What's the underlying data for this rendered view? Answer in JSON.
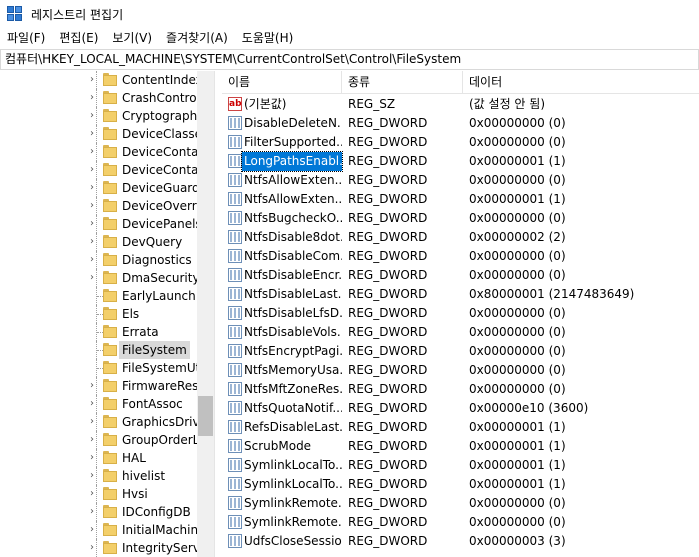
{
  "window": {
    "title": "레지스트리 편집기"
  },
  "menu": [
    {
      "label": "파일(F)"
    },
    {
      "label": "편집(E)"
    },
    {
      "label": "보기(V)"
    },
    {
      "label": "즐겨찾기(A)"
    },
    {
      "label": "도움말(H)"
    }
  ],
  "address": "컴퓨터\\HKEY_LOCAL_MACHINE\\SYSTEM\\CurrentControlSet\\Control\\FileSystem",
  "tree": {
    "selected": "FileSystem",
    "items": [
      {
        "label": "ContentIndex"
      },
      {
        "label": "CrashControl"
      },
      {
        "label": "Cryptography"
      },
      {
        "label": "DeviceClasses"
      },
      {
        "label": "DeviceContair"
      },
      {
        "label": "DeviceContair"
      },
      {
        "label": "DeviceGuard"
      },
      {
        "label": "DeviceOverrid"
      },
      {
        "label": "DevicePanels"
      },
      {
        "label": "DevQuery"
      },
      {
        "label": "Diagnostics"
      },
      {
        "label": "DmaSecurity"
      },
      {
        "label": "EarlyLaunch"
      },
      {
        "label": "Els"
      },
      {
        "label": "Errata"
      },
      {
        "label": "FileSystem"
      },
      {
        "label": "FileSystemUtil"
      },
      {
        "label": "FirmwareReso"
      },
      {
        "label": "FontAssoc"
      },
      {
        "label": "GraphicsDrive"
      },
      {
        "label": "GroupOrderLis"
      },
      {
        "label": "HAL"
      },
      {
        "label": "hivelist"
      },
      {
        "label": "Hvsi"
      },
      {
        "label": "IDConfigDB"
      },
      {
        "label": "InitialMachine"
      },
      {
        "label": "IntegrityServic"
      }
    ]
  },
  "list": {
    "columns": {
      "name": "이름",
      "type": "종류",
      "data": "데이터"
    },
    "rows": [
      {
        "name": "(기본값)",
        "type": "REG_SZ",
        "data": "(값 설정 안 됨)",
        "kind": "sz"
      },
      {
        "name": "DisableDeleteN...",
        "type": "REG_DWORD",
        "data": "0x00000000 (0)",
        "kind": "dword"
      },
      {
        "name": "FilterSupported...",
        "type": "REG_DWORD",
        "data": "0x00000000 (0)",
        "kind": "dword"
      },
      {
        "name": "LongPathsEnabl...",
        "type": "REG_DWORD",
        "data": "0x00000001 (1)",
        "kind": "dword",
        "selected": true
      },
      {
        "name": "NtfsAllowExten...",
        "type": "REG_DWORD",
        "data": "0x00000000 (0)",
        "kind": "dword"
      },
      {
        "name": "NtfsAllowExten...",
        "type": "REG_DWORD",
        "data": "0x00000001 (1)",
        "kind": "dword"
      },
      {
        "name": "NtfsBugcheckO...",
        "type": "REG_DWORD",
        "data": "0x00000000 (0)",
        "kind": "dword"
      },
      {
        "name": "NtfsDisable8dot...",
        "type": "REG_DWORD",
        "data": "0x00000002 (2)",
        "kind": "dword"
      },
      {
        "name": "NtfsDisableCom...",
        "type": "REG_DWORD",
        "data": "0x00000000 (0)",
        "kind": "dword"
      },
      {
        "name": "NtfsDisableEncr...",
        "type": "REG_DWORD",
        "data": "0x00000000 (0)",
        "kind": "dword"
      },
      {
        "name": "NtfsDisableLast...",
        "type": "REG_DWORD",
        "data": "0x80000001 (2147483649)",
        "kind": "dword"
      },
      {
        "name": "NtfsDisableLfsD...",
        "type": "REG_DWORD",
        "data": "0x00000000 (0)",
        "kind": "dword"
      },
      {
        "name": "NtfsDisableVols...",
        "type": "REG_DWORD",
        "data": "0x00000000 (0)",
        "kind": "dword"
      },
      {
        "name": "NtfsEncryptPagi...",
        "type": "REG_DWORD",
        "data": "0x00000000 (0)",
        "kind": "dword"
      },
      {
        "name": "NtfsMemoryUsa...",
        "type": "REG_DWORD",
        "data": "0x00000000 (0)",
        "kind": "dword"
      },
      {
        "name": "NtfsMftZoneRes...",
        "type": "REG_DWORD",
        "data": "0x00000000 (0)",
        "kind": "dword"
      },
      {
        "name": "NtfsQuotaNotif...",
        "type": "REG_DWORD",
        "data": "0x00000e10 (3600)",
        "kind": "dword"
      },
      {
        "name": "RefsDisableLast...",
        "type": "REG_DWORD",
        "data": "0x00000001 (1)",
        "kind": "dword"
      },
      {
        "name": "ScrubMode",
        "type": "REG_DWORD",
        "data": "0x00000001 (1)",
        "kind": "dword"
      },
      {
        "name": "SymlinkLocalTo...",
        "type": "REG_DWORD",
        "data": "0x00000001 (1)",
        "kind": "dword"
      },
      {
        "name": "SymlinkLocalTo...",
        "type": "REG_DWORD",
        "data": "0x00000001 (1)",
        "kind": "dword"
      },
      {
        "name": "SymlinkRemote...",
        "type": "REG_DWORD",
        "data": "0x00000000 (0)",
        "kind": "dword"
      },
      {
        "name": "SymlinkRemote...",
        "type": "REG_DWORD",
        "data": "0x00000000 (0)",
        "kind": "dword"
      },
      {
        "name": "UdfsCloseSessio...",
        "type": "REG_DWORD",
        "data": "0x00000003 (3)",
        "kind": "dword"
      }
    ]
  }
}
